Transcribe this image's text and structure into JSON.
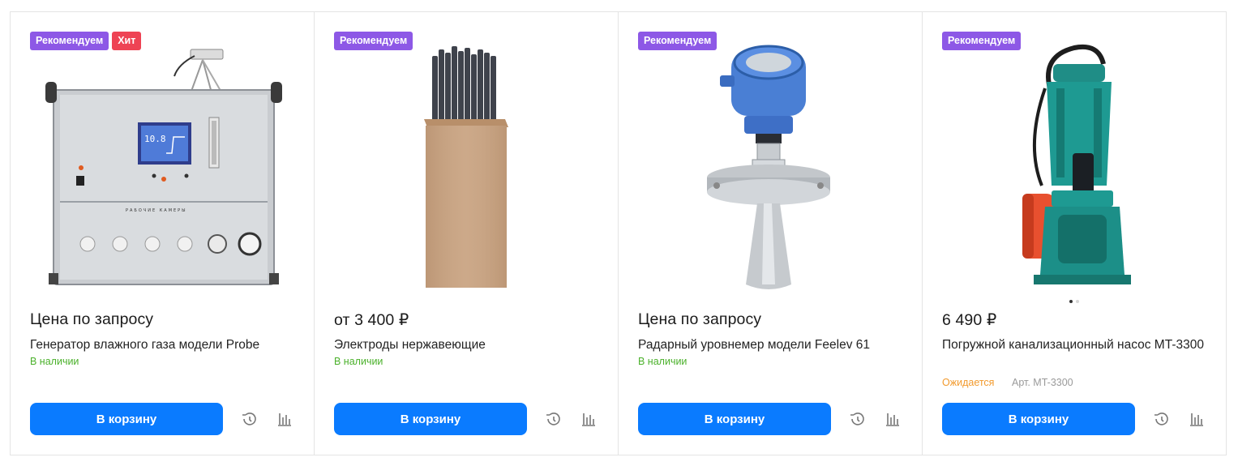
{
  "products": [
    {
      "badges": [
        {
          "label": "Рекомендуем",
          "kind": "rec"
        },
        {
          "label": "Хит",
          "kind": "hit"
        }
      ],
      "price": "Цена по запросу",
      "title": "Генератор влажного газа модели Probe",
      "stock": "В наличии",
      "cart_label": "В корзину"
    },
    {
      "badges": [
        {
          "label": "Рекомендуем",
          "kind": "rec"
        }
      ],
      "price": "от 3 400 ₽",
      "title": "Электроды нержавеющие",
      "stock": "В наличии",
      "cart_label": "В корзину"
    },
    {
      "badges": [
        {
          "label": "Рекомендуем",
          "kind": "rec"
        }
      ],
      "price": "Цена по запросу",
      "title": "Радарный уровнемер модели Feelev 61",
      "stock": "В наличии",
      "cart_label": "В корзину"
    },
    {
      "badges": [
        {
          "label": "Рекомендуем",
          "kind": "rec"
        }
      ],
      "price": "6 490 ₽",
      "title": "Погружной канализационный насос MT-3300",
      "stock": "Ожидается",
      "sku": "Арт. MT-3300",
      "cart_label": "В корзину"
    }
  ],
  "icons": {
    "history": "history-icon",
    "compare": "compare-chart-icon"
  },
  "colors": {
    "accent": "#0a7bff",
    "badge_recommend": "#8d58e6",
    "badge_hit": "#ee4354",
    "in_stock": "#4bb12b",
    "awaiting": "#f29a2d"
  }
}
